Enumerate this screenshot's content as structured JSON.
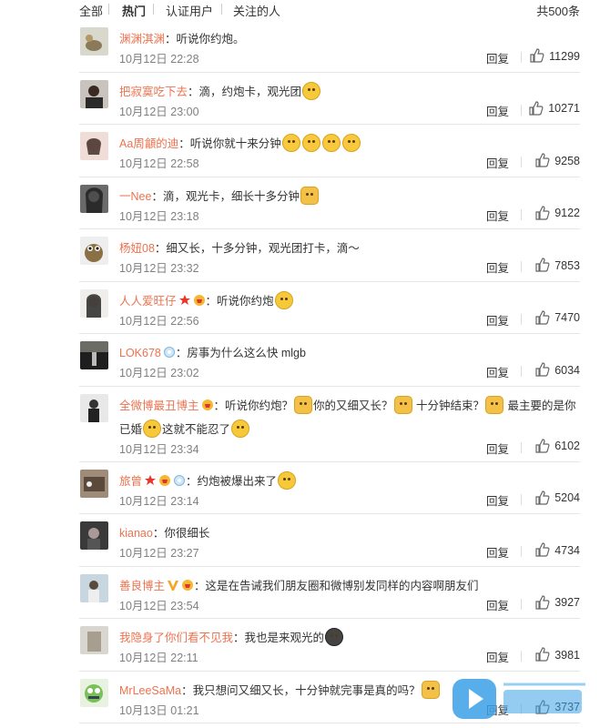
{
  "filters": {
    "all": "全部",
    "hot": "热门",
    "verified": "认证用户",
    "following": "关注的人",
    "total": "共500条"
  },
  "reply_label": "回复",
  "comments": [
    {
      "user": "渊渊淇渊",
      "text": "：听说你约炮。",
      "time": "10月12日 22:28",
      "likes": "11299"
    },
    {
      "user": "把寂寞吃下去",
      "text": "：滴，约炮卡，观光团",
      "time": "10月12日 23:00",
      "likes": "10271"
    },
    {
      "user": "Aa周龥的迪",
      "text": "：听说你就十来分钟",
      "time": "10月12日 22:58",
      "likes": "9258"
    },
    {
      "user": "一Nee",
      "text": "：滴，观光卡，细长十多分钟",
      "time": "10月12日 23:18",
      "likes": "9122"
    },
    {
      "user": "杨妞08",
      "text": "：细又长，十多分钟，观光团打卡，滴～",
      "time": "10月12日 23:32",
      "likes": "7853"
    },
    {
      "user": "人人爱旺仔",
      "text": "：听说你约炮",
      "time": "10月12日 22:56",
      "likes": "7470"
    },
    {
      "user": "LOK678",
      "text": "：房事为什么这么快 mlgb",
      "time": "10月12日 23:02",
      "likes": "6034"
    },
    {
      "user": "全微博最丑博主",
      "text_parts": [
        "：听说你约炮？",
        "你的又细又长？",
        "十分钟结束？",
        "最主要的是你已婚",
        "这就不能忍了"
      ],
      "time": "10月12日 23:34",
      "likes": "6102"
    },
    {
      "user": "旅曾",
      "text": "：约炮被爆出来了",
      "time": "10月12日 23:14",
      "likes": "5204"
    },
    {
      "user": "kianao",
      "text": "：你很细长",
      "time": "10月12日 23:27",
      "likes": "4734"
    },
    {
      "user": "善良博主",
      "text": "：这是在告诫我们朋友圈和微博别发同样的内容啊朋友们",
      "time": "10月12日 23:54",
      "likes": "3927"
    },
    {
      "user": "我隐身了你们看不见我",
      "text": "：我也是来观光的",
      "time": "10月12日 22:11",
      "likes": "3981"
    },
    {
      "user": "MrLeeSaMa",
      "text": "：我只想问又细又长，十分钟就完事是真的吗？",
      "time": "10月13日 01:21",
      "likes": "3737"
    }
  ],
  "colors": {
    "username": "#eb7350",
    "time": "#808080",
    "divider": "#e6e6e6",
    "accent": "#3aa0e6"
  }
}
